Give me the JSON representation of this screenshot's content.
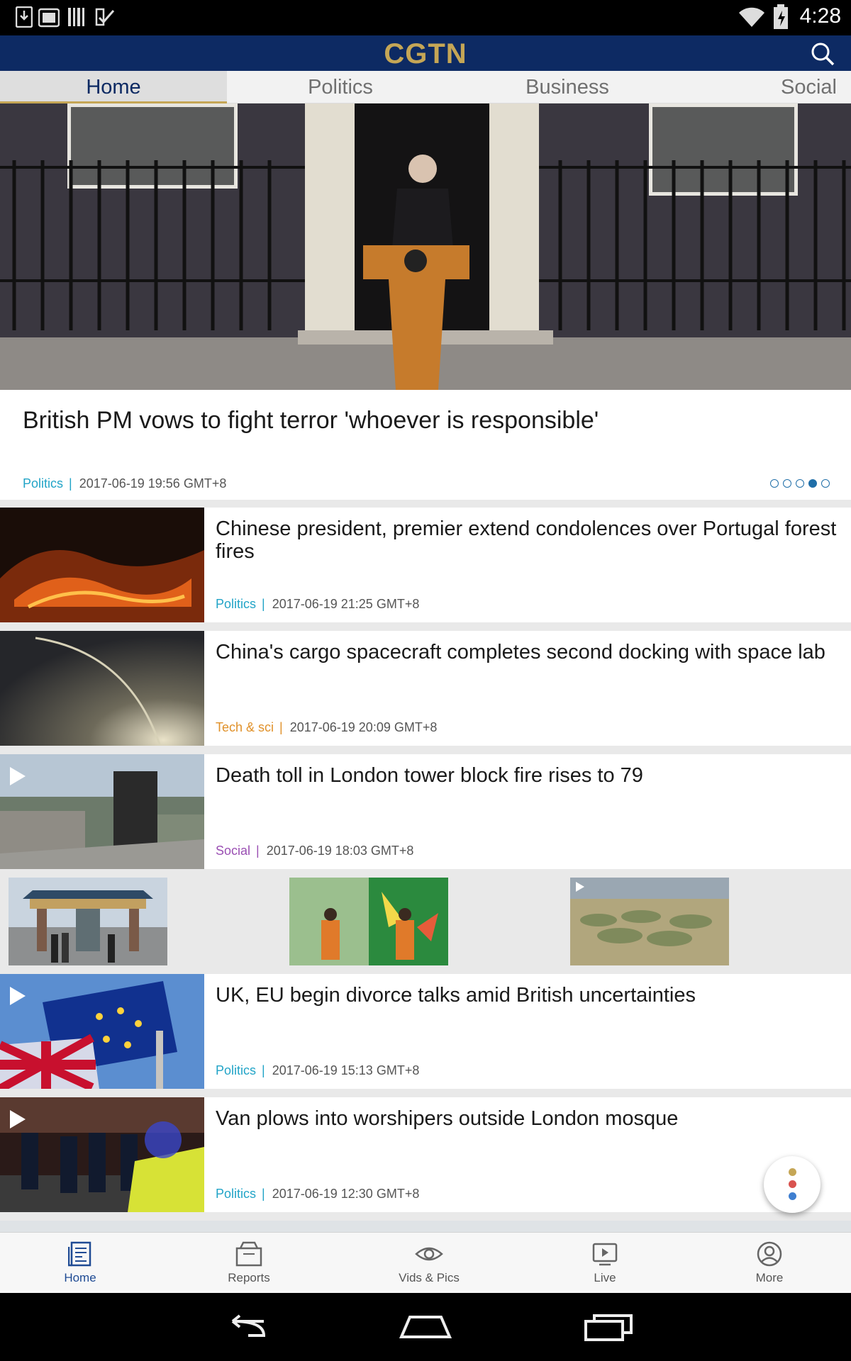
{
  "status_bar": {
    "time": "4:28",
    "icons": [
      "download-icon",
      "photo-icon",
      "barcode-icon",
      "check-icon",
      "wifi-icon",
      "battery-icon"
    ]
  },
  "app_bar": {
    "logo": "CGTN",
    "search_icon": "search-icon"
  },
  "tabs": [
    {
      "label": "Home",
      "active": true
    },
    {
      "label": "Politics",
      "active": false
    },
    {
      "label": "Business",
      "active": false
    },
    {
      "label": "Social",
      "active": false
    }
  ],
  "hero": {
    "title": "British PM vows to fight terror 'whoever is responsible'",
    "category": "Politics",
    "separator": "|",
    "timestamp": "2017-06-19 19:56 GMT+8",
    "carousel_total": 5,
    "carousel_active_index": 3
  },
  "articles": [
    {
      "title": "Chinese president, premier extend condolences over Portugal forest fires",
      "category": "Politics",
      "separator": "|",
      "timestamp": "2017-06-19 21:25 GMT+8",
      "video": false
    },
    {
      "title": "China's cargo spacecraft completes second docking with space lab",
      "category": "Tech & sci",
      "separator": "|",
      "timestamp": "2017-06-19 20:09 GMT+8",
      "video": false
    },
    {
      "title": "Death toll in London tower block fire rises to 79",
      "category": "Social",
      "separator": "|",
      "timestamp": "2017-06-19 18:03 GMT+8",
      "video": true
    },
    {
      "title": "UK, EU begin divorce talks amid British uncertainties",
      "category": "Politics",
      "separator": "|",
      "timestamp": "2017-06-19 15:13 GMT+8",
      "video": true
    },
    {
      "title": "Van plows into worshipers outside London mosque",
      "category": "Politics",
      "separator": "|",
      "timestamp": "2017-06-19 12:30 GMT+8",
      "video": true
    }
  ],
  "gallery": [
    {
      "icon": "photo-icon"
    },
    {
      "icon": "photo-icon"
    },
    {
      "icon": "play-icon"
    }
  ],
  "fab": {
    "icon": "more-vertical-icon",
    "colors": [
      "#c5a656",
      "#d9534f",
      "#3f7fd0"
    ]
  },
  "bottom_nav": [
    {
      "label": "Home",
      "icon": "newspaper-icon",
      "active": true
    },
    {
      "label": "Reports",
      "icon": "reports-icon",
      "active": false
    },
    {
      "label": "Vids & Pics",
      "icon": "eye-icon",
      "active": false
    },
    {
      "label": "Live",
      "icon": "live-play-icon",
      "active": false
    },
    {
      "label": "More",
      "icon": "user-icon",
      "active": false
    }
  ],
  "system_nav": [
    "back-icon",
    "home-icon",
    "recents-icon"
  ],
  "colors": {
    "brand_navy": "#0d2a63",
    "brand_gold": "#c5a656",
    "politics": "#22a4c7",
    "tech": "#e0912a",
    "social": "#9a4fb3",
    "active_nav": "#1f4b94"
  }
}
